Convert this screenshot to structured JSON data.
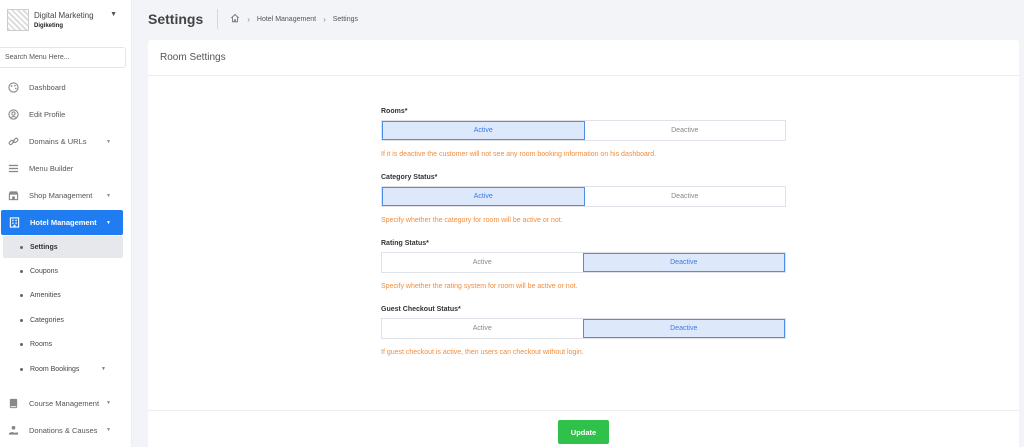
{
  "brand": {
    "name": "Digital Marketing",
    "user": "Digiketing"
  },
  "sidebar": {
    "search_placeholder": "Search Menu Here...",
    "items": [
      {
        "label": "Dashboard",
        "icon": "palette-icon",
        "has_caret": false
      },
      {
        "label": "Edit Profile",
        "icon": "user-circle-icon",
        "has_caret": false
      },
      {
        "label": "Domains & URLs",
        "icon": "link-icon",
        "has_caret": true
      },
      {
        "label": "Menu Builder",
        "icon": "bars-icon",
        "has_caret": false
      },
      {
        "label": "Shop Management",
        "icon": "store-icon",
        "has_caret": true
      },
      {
        "label": "Hotel Management",
        "icon": "hotel-icon",
        "has_caret": true,
        "active": true
      }
    ],
    "hotel_submenu": [
      {
        "label": "Settings",
        "active": true
      },
      {
        "label": "Coupons"
      },
      {
        "label": "Amenities"
      },
      {
        "label": "Categories"
      },
      {
        "label": "Rooms"
      },
      {
        "label": "Room Bookings",
        "has_caret": true
      }
    ],
    "bottom_items": [
      {
        "label": "Course Management",
        "icon": "book-icon",
        "has_caret": true
      },
      {
        "label": "Donations & Causes",
        "icon": "donate-icon",
        "has_caret": true
      }
    ]
  },
  "header": {
    "title": "Settings",
    "breadcrumb": [
      "Hotel Management",
      "Settings"
    ]
  },
  "card": {
    "title": "Room Settings",
    "fields": [
      {
        "label": "Rooms*",
        "options": [
          "Active",
          "Deactive"
        ],
        "selected": "Active",
        "hint": "If it is deactive the customer will not see any room booking information on his dashboard."
      },
      {
        "label": "Category Status*",
        "options": [
          "Active",
          "Deactive"
        ],
        "selected": "Active",
        "hint": "Specify whether the category for room will be active or not."
      },
      {
        "label": "Rating Status*",
        "options": [
          "Active",
          "Deactive"
        ],
        "selected": "Deactive",
        "hint": "Specify whether the rating system for room will be active or not."
      },
      {
        "label": "Guest Checkout Status*",
        "options": [
          "Active",
          "Deactive"
        ],
        "selected": "Deactive",
        "hint": "If guest checkout is active, then users can checkout without login."
      }
    ],
    "submit_label": "Update"
  },
  "colors": {
    "accent": "#1f7cf1",
    "selected_bg": "#dde8fb",
    "hint": "#f28c3a",
    "success": "#2fc14a"
  }
}
